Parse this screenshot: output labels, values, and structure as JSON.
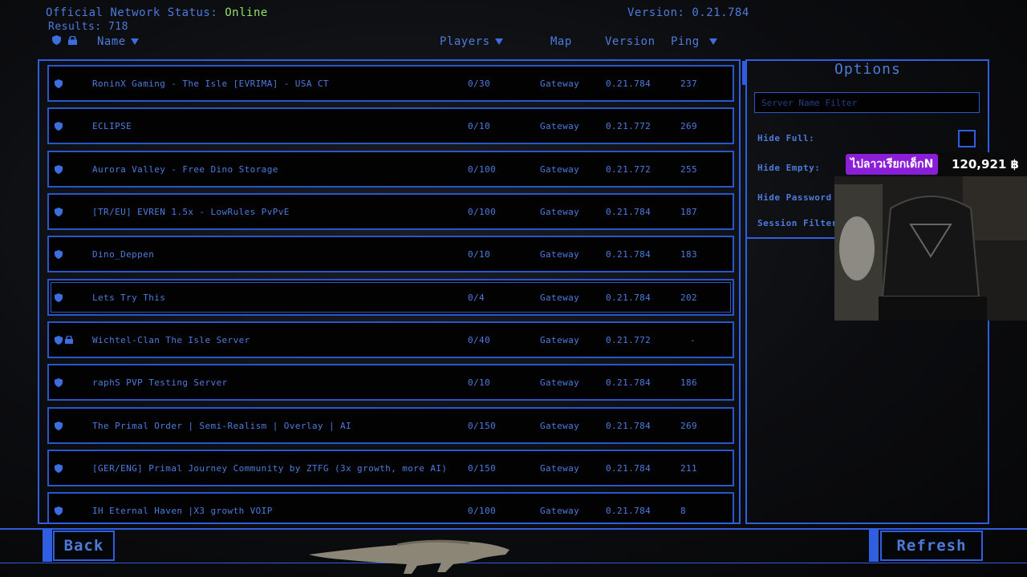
{
  "header": {
    "status_prefix": "Official Network Status:",
    "status_value": "Online",
    "results_label": "Results:",
    "results_count": "718",
    "version_text": "Version: 0.21.784"
  },
  "columns": {
    "name": "Name",
    "players": "Players",
    "map": "Map",
    "version": "Version",
    "ping": "Ping"
  },
  "servers": [
    {
      "name": "RoninX Gaming - The Isle [EVRIMA] - USA CT",
      "players": "0/30",
      "map": "Gateway",
      "version": "0.21.784",
      "ping": "237",
      "locked": false
    },
    {
      "name": "ECLIPSE",
      "players": "0/10",
      "map": "Gateway",
      "version": "0.21.772",
      "ping": "269",
      "locked": false
    },
    {
      "name": "Aurora Valley - Free Dino Storage",
      "players": "0/100",
      "map": "Gateway",
      "version": "0.21.772",
      "ping": "255",
      "locked": false
    },
    {
      "name": "[TR/EU] EVREN 1.5x - LowRules PvPvE",
      "players": "0/100",
      "map": "Gateway",
      "version": "0.21.784",
      "ping": "187",
      "locked": false
    },
    {
      "name": "Dino_Deppen",
      "players": "0/10",
      "map": "Gateway",
      "version": "0.21.784",
      "ping": "183",
      "locked": false
    },
    {
      "name": "Lets Try This",
      "players": "0/4",
      "map": "Gateway",
      "version": "0.21.784",
      "ping": "202",
      "locked": false
    },
    {
      "name": "Wichtel-Clan The Isle Server",
      "players": "0/40",
      "map": "Gateway",
      "version": "0.21.772",
      "ping": "-",
      "locked": true
    },
    {
      "name": "raphS PVP Testing Server",
      "players": "0/10",
      "map": "Gateway",
      "version": "0.21.784",
      "ping": "186",
      "locked": false
    },
    {
      "name": "The Primal Order | Semi-Realism | Overlay | AI",
      "players": "0/150",
      "map": "Gateway",
      "version": "0.21.784",
      "ping": "269",
      "locked": false
    },
    {
      "name": "[GER/ENG] Primal Journey Community by ZTFG (3x growth, more AI)",
      "players": "0/150",
      "map": "Gateway",
      "version": "0.21.784",
      "ping": "211",
      "locked": false
    },
    {
      "name": "IH Eternal Haven |X3 growth VOIP",
      "players": "0/100",
      "map": "Gateway",
      "version": "0.21.784",
      "ping": "8",
      "locked": false
    }
  ],
  "options": {
    "title": "Options",
    "filter_placeholder": "Server Name Filter",
    "hide_full": "Hide Full:",
    "hide_empty": "Hide Empty:",
    "hide_password": "Hide Password P",
    "session_filter": "Session Filter"
  },
  "buttons": {
    "back": "Back",
    "refresh": "Refresh"
  },
  "overlay": {
    "donation_name": "ไปลาวเรียกเด็กN",
    "donation_amount": "120,921 ฿"
  }
}
